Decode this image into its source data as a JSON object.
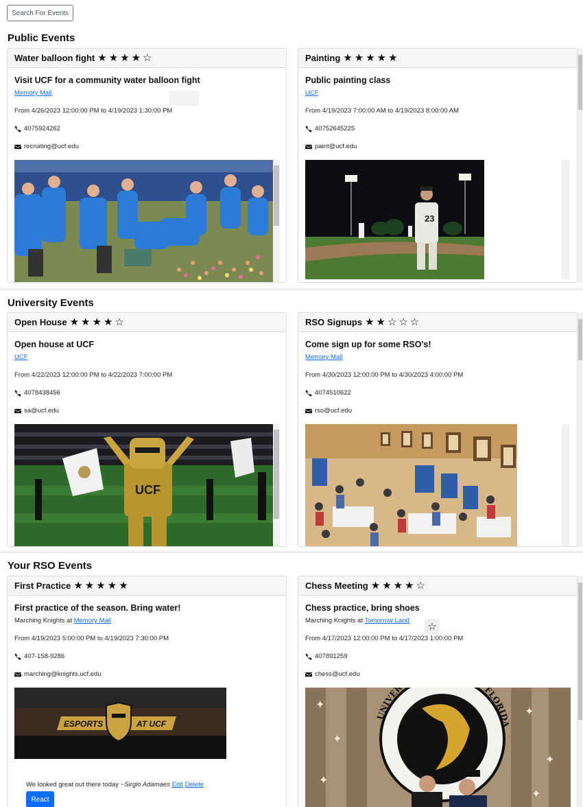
{
  "search": {
    "label": "Search For Events"
  },
  "sections": {
    "public": "Public Events",
    "university": "University Events",
    "rso": "Your RSO Events"
  },
  "events": {
    "water": {
      "name": "Water balloon fight",
      "rating": 4,
      "max_rating": 5,
      "title": "Visit UCF for a community water balloon fight",
      "location": "Memory Mall",
      "time": "From 4/26/2023 12:00:00 PM to 4/19/2023 1:30:00 PM",
      "phone": "4075924262",
      "email": "recruiting@ucf.edu"
    },
    "painting": {
      "name": "Painting",
      "rating": 5,
      "max_rating": 5,
      "title": "Public painting class",
      "location": "UCF",
      "time": "From 4/19/2023 7:00:00 AM to 4/19/2023 8:00:00 AM",
      "phone": "40752645225",
      "email": "paint@ucf.edu",
      "jersey_number": "23"
    },
    "openhouse": {
      "name": "Open House",
      "rating": 4,
      "max_rating": 5,
      "title": "Open house at UCF",
      "location": "UCF",
      "time": "From 4/22/2023 12:00:00 PM to 4/22/2023 7:00:00 PM",
      "phone": "4078438456",
      "email": "sa@ucf.edu",
      "mascot_text": "UCF"
    },
    "rso": {
      "name": "RSO Signups",
      "rating": 2,
      "max_rating": 5,
      "title": "Come sign up for some RSO's!",
      "location": "Memory Mall",
      "time": "From 4/30/2023 12:00:00 PM to 4/30/2023 4:00:00 PM",
      "phone": "4074510622",
      "email": "rso@ucf.edu"
    },
    "practice": {
      "name": "First Practice",
      "rating": 5,
      "max_rating": 5,
      "title": "First practice of the season. Bring water!",
      "host": "Marching Knights at",
      "location": "Memory Mall",
      "time": "From 4/19/2023 5:00:00 PM to 4/19/2023 7:30:00 PM",
      "phone": "407-158-9286",
      "email": "marching@knights.ucf.edu",
      "banner_left": "ESPORTS",
      "banner_right": "AT UCF",
      "comment": {
        "text": "We looked great out there today ~",
        "author": "Sirgio Adamaes",
        "edit": "Edit",
        "delete": "Delete"
      },
      "react_label": "React"
    },
    "chess": {
      "name": "Chess Meeting",
      "rating": 4,
      "max_rating": 5,
      "title": "Chess practice, bring shoes",
      "host": "Marching Knights at",
      "location": "Tomorrow Land",
      "time": "From 4/17/2023 12:00:00 PM to 4/17/2023 1:00:00 PM",
      "phone": "407891259",
      "email": "chess@ucf.edu",
      "seal_text": "UNIVERSITY OF CENTRAL FLORIDA"
    }
  },
  "colors": {
    "link": "#0d6efd",
    "button": "#0d6efd",
    "header_bg": "#f5f5f5"
  }
}
